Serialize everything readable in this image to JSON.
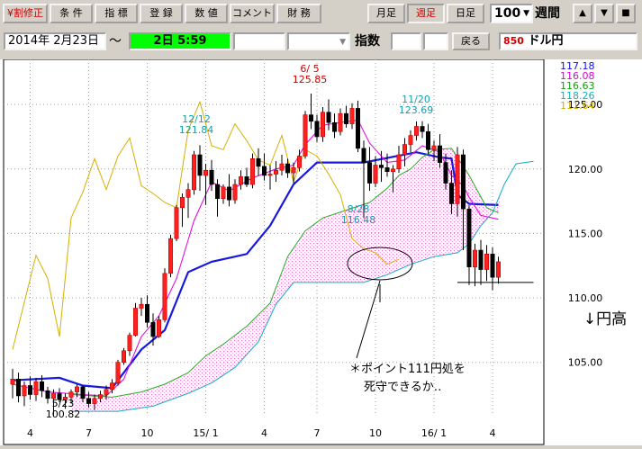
{
  "toolbar": {
    "buttons": [
      "¥割修正",
      "条 件",
      "指 標",
      "登 録",
      "数 値",
      "コメント",
      "財 務"
    ],
    "periods": [
      "月足",
      "週足",
      "日足"
    ],
    "count": "100",
    "count_arrow": "▼",
    "unit": "週間",
    "arrows": [
      "▲",
      "▼",
      "■"
    ]
  },
  "date_row": {
    "date": "2014年 2月23日",
    "tilde": "〜",
    "status": "2日 5:59",
    "index_label": "指数",
    "back_label": "戻る",
    "code": "850",
    "name": "ドル円"
  },
  "chart_data": {
    "type": "candlestick",
    "instrument": "ドル円",
    "interval": "週足",
    "ylim": [
      101.0,
      128.5
    ],
    "yticks": [
      105.0,
      110.0,
      115.0,
      120.0,
      125.0
    ],
    "ytick_labels": [
      "105.00",
      "110.00",
      "115.00",
      "120.00",
      "125.00"
    ],
    "x_tick_labels": [
      "4",
      "7",
      "10",
      "15/ 1",
      "4",
      "7",
      "10",
      "16/ 1",
      "4"
    ],
    "legend": [
      {
        "value": "117.18",
        "color": "#1010e0"
      },
      {
        "value": "116.08",
        "color": "#e000e0"
      },
      {
        "value": "116.63",
        "color": "#10a010"
      },
      {
        "value": "118.26",
        "color": "#10b0c0"
      },
      {
        "value": "111.64",
        "color": "#d0b000"
      }
    ],
    "extreme_labels": [
      {
        "date": "6/ 5",
        "price": "125.85",
        "color": "#d00000"
      },
      {
        "date": "12/12",
        "price": "121.84",
        "color": "#10a0b0"
      },
      {
        "date": "11/20",
        "price": "123.69",
        "color": "#10a0b0"
      },
      {
        "date": "8/28",
        "price": "116.48",
        "color": "#10a0b0"
      },
      {
        "date": "5/23",
        "price": "100.82",
        "color": "#000000"
      }
    ],
    "annotation_right": "↓円高",
    "annotation_note": [
      "＊ポイント111円処を",
      "死守できるか‥"
    ],
    "support_level": 111.2,
    "candles": [
      [
        103.3,
        104.5,
        102.2,
        103.7
      ],
      [
        103.7,
        104.2,
        101.9,
        102.4
      ],
      [
        102.4,
        103.5,
        101.6,
        103.2
      ],
      [
        103.2,
        103.9,
        102.1,
        102.5
      ],
      [
        102.5,
        103.8,
        102.0,
        103.5
      ],
      [
        103.5,
        104.0,
        102.3,
        102.8
      ],
      [
        102.8,
        103.1,
        101.8,
        102.2
      ],
      [
        102.2,
        102.9,
        100.82,
        102.6
      ],
      [
        102.6,
        103.0,
        101.9,
        102.1
      ],
      [
        102.1,
        102.6,
        101.4,
        102.3
      ],
      [
        102.3,
        102.9,
        101.8,
        102.7
      ],
      [
        102.7,
        103.3,
        102.3,
        103.1
      ],
      [
        103.1,
        103.2,
        101.9,
        102.2
      ],
      [
        102.2,
        102.7,
        101.5,
        101.8
      ],
      [
        101.8,
        102.5,
        101.3,
        102.2
      ],
      [
        102.2,
        102.8,
        101.9,
        102.5
      ],
      [
        102.5,
        103.2,
        102.1,
        102.9
      ],
      [
        102.9,
        103.7,
        102.6,
        103.4
      ],
      [
        103.4,
        105.2,
        103.2,
        105.0
      ],
      [
        105.0,
        106.1,
        104.8,
        105.9
      ],
      [
        105.9,
        107.3,
        105.5,
        107.1
      ],
      [
        107.1,
        109.6,
        107.0,
        109.2
      ],
      [
        109.2,
        110.0,
        108.6,
        109.5
      ],
      [
        109.5,
        110.2,
        107.7,
        108.1
      ],
      [
        108.1,
        108.8,
        106.3,
        107.0
      ],
      [
        107.0,
        108.6,
        106.9,
        108.3
      ],
      [
        108.3,
        112.3,
        108.1,
        111.9
      ],
      [
        111.9,
        114.9,
        111.6,
        114.6
      ],
      [
        114.6,
        117.2,
        114.4,
        117.0
      ],
      [
        117.0,
        118.1,
        115.5,
        117.8
      ],
      [
        117.8,
        118.9,
        116.2,
        118.4
      ],
      [
        118.4,
        121.4,
        118.0,
        121.1
      ],
      [
        121.1,
        121.84,
        118.3,
        119.5
      ],
      [
        119.5,
        120.4,
        117.2,
        119.9
      ],
      [
        119.9,
        120.7,
        118.3,
        118.8
      ],
      [
        118.8,
        119.2,
        116.3,
        117.7
      ],
      [
        117.7,
        118.8,
        117.3,
        118.6
      ],
      [
        118.6,
        119.6,
        117.1,
        117.6
      ],
      [
        117.6,
        119.2,
        117.3,
        118.8
      ],
      [
        118.8,
        119.9,
        118.4,
        119.4
      ],
      [
        119.4,
        120.1,
        118.6,
        118.8
      ],
      [
        118.8,
        121.2,
        118.5,
        120.8
      ],
      [
        120.8,
        121.6,
        119.5,
        120.2
      ],
      [
        120.2,
        121.2,
        119.1,
        119.5
      ],
      [
        119.5,
        120.3,
        118.4,
        119.6
      ],
      [
        119.6,
        120.6,
        119.0,
        119.9
      ],
      [
        119.9,
        121.1,
        119.5,
        120.4
      ],
      [
        120.4,
        120.8,
        119.3,
        119.7
      ],
      [
        119.7,
        120.5,
        118.9,
        120.1
      ],
      [
        120.1,
        121.5,
        119.8,
        121.0
      ],
      [
        121.0,
        124.5,
        120.8,
        124.2
      ],
      [
        124.2,
        125.85,
        123.1,
        123.7
      ],
      [
        123.7,
        124.2,
        122.1,
        122.5
      ],
      [
        122.5,
        124.8,
        122.1,
        124.4
      ],
      [
        124.4,
        125.4,
        123.0,
        123.6
      ],
      [
        123.6,
        124.3,
        122.4,
        122.9
      ],
      [
        122.9,
        124.7,
        122.6,
        124.3
      ],
      [
        124.3,
        124.9,
        123.2,
        123.5
      ],
      [
        123.5,
        125.1,
        123.1,
        124.7
      ],
      [
        124.7,
        125.3,
        121.3,
        121.6
      ],
      [
        121.6,
        122.2,
        116.2,
        120.5
      ],
      [
        120.5,
        121.7,
        118.3,
        118.9
      ],
      [
        118.9,
        121.0,
        118.6,
        120.3
      ],
      [
        120.3,
        121.4,
        119.0,
        120.1
      ],
      [
        120.1,
        121.2,
        119.4,
        119.8
      ],
      [
        119.8,
        120.3,
        118.2,
        120.0
      ],
      [
        120.0,
        121.8,
        119.7,
        121.1
      ],
      [
        121.1,
        122.4,
        120.2,
        121.9
      ],
      [
        121.9,
        123.0,
        121.3,
        122.6
      ],
      [
        122.6,
        123.69,
        122.2,
        123.3
      ],
      [
        123.3,
        123.7,
        122.4,
        122.9
      ],
      [
        122.9,
        123.5,
        121.2,
        121.5
      ],
      [
        121.5,
        122.2,
        120.6,
        121.8
      ],
      [
        121.8,
        122.7,
        120.1,
        120.5
      ],
      [
        120.5,
        121.2,
        118.4,
        118.9
      ],
      [
        118.9,
        119.9,
        116.5,
        117.3
      ],
      [
        117.3,
        121.7,
        116.3,
        121.1
      ],
      [
        121.1,
        121.5,
        113.7,
        116.9
      ],
      [
        116.9,
        117.2,
        111.0,
        112.4
      ],
      [
        112.4,
        114.2,
        110.9,
        113.7
      ],
      [
        113.7,
        114.5,
        111.0,
        112.2
      ],
      [
        112.2,
        114.1,
        111.3,
        113.4
      ],
      [
        113.4,
        113.9,
        110.6,
        111.6
      ],
      [
        111.6,
        113.2,
        111.1,
        112.8
      ]
    ],
    "series": [
      {
        "color": "#1818e0",
        "width": 2.2,
        "values": [
          [
            0,
            103.6
          ],
          [
            8,
            103.8
          ],
          [
            12,
            103.2
          ],
          [
            17,
            103.0
          ],
          [
            22,
            106.0
          ],
          [
            26,
            107.5
          ],
          [
            30,
            112.0
          ],
          [
            34,
            112.8
          ],
          [
            40,
            113.4
          ],
          [
            44,
            115.6
          ],
          [
            48,
            118.8
          ],
          [
            52,
            120.5
          ],
          [
            60,
            120.5
          ],
          [
            69,
            121.3
          ],
          [
            73,
            120.9
          ],
          [
            75,
            120.8
          ],
          [
            76,
            118.0
          ],
          [
            78,
            117.3
          ],
          [
            83,
            117.2
          ]
        ]
      },
      {
        "color": "#e010e0",
        "width": 1.1,
        "values": [
          [
            0,
            103.3
          ],
          [
            6,
            102.7
          ],
          [
            12,
            102.5
          ],
          [
            16,
            102.4
          ],
          [
            19,
            103.7
          ],
          [
            22,
            107.0
          ],
          [
            25,
            108.6
          ],
          [
            28,
            111.5
          ],
          [
            31,
            116.0
          ],
          [
            34,
            119.0
          ],
          [
            37,
            118.3
          ],
          [
            41,
            119.3
          ],
          [
            45,
            120.0
          ],
          [
            48,
            120.3
          ],
          [
            50,
            121.9
          ],
          [
            53,
            123.4
          ],
          [
            56,
            123.6
          ],
          [
            59,
            123.8
          ],
          [
            61,
            122.0
          ],
          [
            64,
            120.5
          ],
          [
            67,
            120.7
          ],
          [
            70,
            121.8
          ],
          [
            73,
            121.3
          ],
          [
            75,
            119.5
          ],
          [
            77,
            118.7
          ],
          [
            78,
            117.8
          ],
          [
            80,
            116.4
          ],
          [
            83,
            116.1
          ]
        ]
      },
      {
        "color": "#20b020",
        "width": 1.0,
        "values": [
          [
            10,
            102.5
          ],
          [
            17,
            102.3
          ],
          [
            22,
            102.7
          ],
          [
            26,
            103.3
          ],
          [
            30,
            104.2
          ],
          [
            33,
            105.5
          ],
          [
            36,
            106.4
          ],
          [
            40,
            107.8
          ],
          [
            44,
            109.6
          ],
          [
            47,
            113.2
          ],
          [
            50,
            115.2
          ],
          [
            53,
            116.2
          ],
          [
            57,
            116.8
          ],
          [
            61,
            117.4
          ],
          [
            64,
            118.5
          ],
          [
            66,
            119.5
          ],
          [
            68,
            120.0
          ],
          [
            70,
            120.9
          ],
          [
            72,
            121.5
          ],
          [
            75,
            121.6
          ],
          [
            78,
            119.5
          ],
          [
            81,
            117.0
          ],
          [
            83,
            116.6
          ]
        ]
      },
      {
        "color": "#10b0c0",
        "width": 1.0,
        "values": [
          [
            10,
            101.2
          ],
          [
            18,
            101.2
          ],
          [
            24,
            101.6
          ],
          [
            30,
            102.6
          ],
          [
            34,
            103.4
          ],
          [
            38,
            104.6
          ],
          [
            42,
            106.6
          ],
          [
            45,
            109.5
          ],
          [
            48,
            111.2
          ],
          [
            56,
            111.2
          ],
          [
            60,
            111.2
          ],
          [
            64,
            111.8
          ],
          [
            68,
            112.6
          ],
          [
            72,
            113.2
          ],
          [
            76,
            113.5
          ],
          [
            78,
            114.2
          ],
          [
            80,
            115.6
          ],
          [
            82,
            116.6
          ],
          [
            84,
            118.8
          ],
          [
            86,
            120.4
          ],
          [
            89,
            120.6
          ]
        ]
      },
      {
        "color": "#d4b000",
        "width": 1.0,
        "values": [
          [
            0,
            106.0
          ],
          [
            4,
            113.3
          ],
          [
            6,
            111.5
          ],
          [
            8,
            107.0
          ],
          [
            10,
            116.2
          ],
          [
            12,
            118.2
          ],
          [
            14,
            120.8
          ],
          [
            16,
            118.4
          ],
          [
            18,
            121.0
          ],
          [
            20,
            122.4
          ],
          [
            22,
            118.7
          ],
          [
            24,
            118.1
          ],
          [
            26,
            117.4
          ],
          [
            28,
            117.0
          ],
          [
            30,
            123.0
          ],
          [
            32,
            125.2
          ],
          [
            34,
            121.8
          ],
          [
            36,
            121.5
          ],
          [
            38,
            123.5
          ],
          [
            40,
            122.2
          ],
          [
            42,
            120.7
          ],
          [
            44,
            120.3
          ],
          [
            46,
            122.6
          ],
          [
            48,
            119.0
          ],
          [
            50,
            121.5
          ],
          [
            52,
            121.0
          ],
          [
            54,
            119.6
          ],
          [
            56,
            118.0
          ],
          [
            58,
            114.6
          ],
          [
            60,
            113.8
          ],
          [
            62,
            113.5
          ],
          [
            64,
            112.6
          ],
          [
            66,
            113.0
          ]
        ]
      }
    ]
  }
}
